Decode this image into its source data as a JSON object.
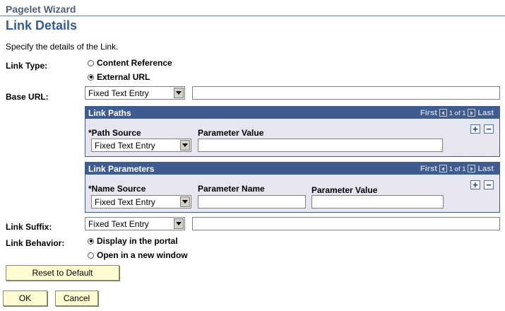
{
  "wizard": {
    "title": "Pagelet Wizard"
  },
  "page": {
    "title": "Link Details",
    "instructions": "Specify the details of the Link."
  },
  "link_type": {
    "label": "Link Type:",
    "options": [
      {
        "label": "Content Reference",
        "selected": false
      },
      {
        "label": "External URL",
        "selected": true
      }
    ]
  },
  "base_url": {
    "label": "Base URL:",
    "source_value": "Fixed Text Entry",
    "text_value": ""
  },
  "link_paths": {
    "title": "Link Paths",
    "nav": {
      "first": "First",
      "count": "1 of 1",
      "last": "Last"
    },
    "columns": [
      "*Path Source",
      "Parameter Value"
    ],
    "rows": [
      {
        "path_source": "Fixed Text Entry",
        "parameter_value": ""
      }
    ],
    "add_symbol": "+",
    "remove_symbol": "−"
  },
  "link_parameters": {
    "title": "Link Parameters",
    "nav": {
      "first": "First",
      "count": "1 of 1",
      "last": "Last"
    },
    "columns": [
      "*Name Source",
      "Parameter Name",
      "Parameter Value"
    ],
    "rows": [
      {
        "name_source": "Fixed Text Entry",
        "parameter_name": "",
        "parameter_value": ""
      }
    ],
    "add_symbol": "+",
    "remove_symbol": "−"
  },
  "link_suffix": {
    "label": "Link Suffix:",
    "source_value": "Fixed Text Entry",
    "text_value": ""
  },
  "link_behavior": {
    "label": "Link Behavior:",
    "options": [
      {
        "label": "Display in the portal",
        "selected": true
      },
      {
        "label": "Open in a new window",
        "selected": false
      }
    ]
  },
  "buttons": {
    "reset": "Reset to Default",
    "ok": "OK",
    "cancel": "Cancel"
  },
  "colors": {
    "page_title": "#335b9b",
    "grid_header": "#3e5c8f",
    "grid_body": "#e6e6f0",
    "button_bg": "#fffcd2"
  }
}
